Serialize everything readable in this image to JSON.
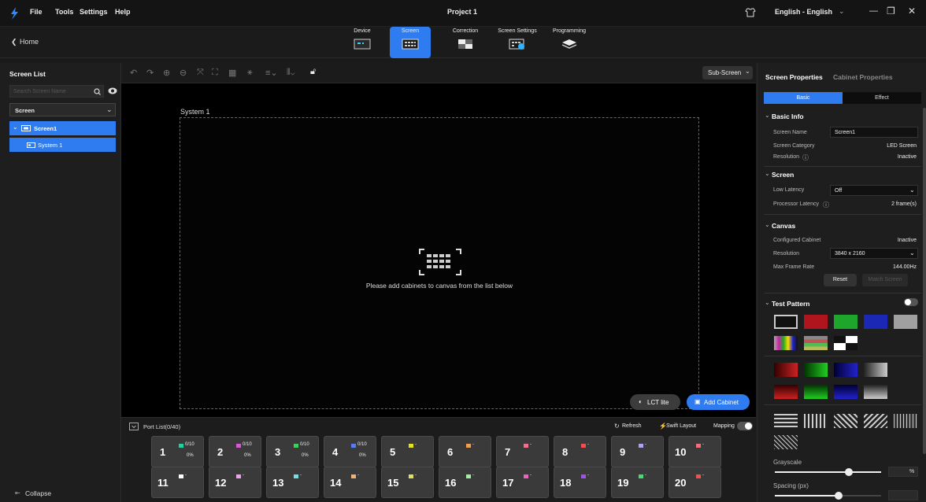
{
  "titlebar": {
    "menus": [
      "File",
      "Tools",
      "Settings",
      "Help"
    ],
    "project": "Project 1",
    "language": "English - English",
    "win_min": "—",
    "win_max": "❐",
    "win_close": "✕"
  },
  "nav": {
    "home": "Home",
    "tabs": [
      {
        "label": "Device"
      },
      {
        "label": "Screen",
        "active": true
      },
      {
        "label": "Correction"
      },
      {
        "label": "Screen Settings"
      },
      {
        "label": "Programming"
      }
    ]
  },
  "left": {
    "title": "Screen List",
    "search_placeholder": "Search Screen Name",
    "filter": "Screen",
    "tree": [
      {
        "label": "Screen1"
      },
      {
        "label": "System 1"
      }
    ],
    "collapse": "Collapse"
  },
  "canvas": {
    "subscreen": "Sub-Screen",
    "system_label": "System 1",
    "empty_msg": "Please add cabinets to canvas from the list below",
    "lct_btn": "LCT lite",
    "add_btn": "Add Cabinet"
  },
  "ports": {
    "title": "Port List(0/40)",
    "refresh": "Refresh",
    "swift": "Swift Layout",
    "mapping": "Mapping",
    "row1": [
      {
        "n": "1",
        "cnt": "0/10",
        "pct": "0%",
        "color": "#1fd1a0"
      },
      {
        "n": "2",
        "cnt": "0/10",
        "pct": "0%",
        "color": "#d65ad6"
      },
      {
        "n": "3",
        "cnt": "0/10",
        "pct": "0%",
        "color": "#3fcf5a"
      },
      {
        "n": "4",
        "cnt": "0/10",
        "pct": "0%",
        "color": "#5b7cf0"
      },
      {
        "n": "5",
        "cnt": "-",
        "pct": "",
        "color": "#e5e21b"
      },
      {
        "n": "6",
        "cnt": "-",
        "pct": "",
        "color": "#f0a050"
      },
      {
        "n": "7",
        "cnt": "-",
        "pct": "",
        "color": "#f07090"
      },
      {
        "n": "8",
        "cnt": "-",
        "pct": "",
        "color": "#f05050"
      },
      {
        "n": "9",
        "cnt": "-",
        "pct": "",
        "color": "#b0a0f0"
      },
      {
        "n": "10",
        "cnt": "-",
        "pct": "",
        "color": "#f07080"
      }
    ],
    "row2": [
      {
        "n": "11",
        "cnt": "-",
        "pct": "",
        "color": "#ffffff"
      },
      {
        "n": "12",
        "cnt": "-",
        "pct": "",
        "color": "#f0a0f0"
      },
      {
        "n": "13",
        "cnt": "-",
        "pct": "",
        "color": "#70e0e0"
      },
      {
        "n": "14",
        "cnt": "-",
        "pct": "",
        "color": "#f0b070"
      },
      {
        "n": "15",
        "cnt": "-",
        "pct": "",
        "color": "#e0e060"
      },
      {
        "n": "16",
        "cnt": "-",
        "pct": "",
        "color": "#a0f0a0"
      },
      {
        "n": "17",
        "cnt": "-",
        "pct": "",
        "color": "#f060c0"
      },
      {
        "n": "18",
        "cnt": "-",
        "pct": "",
        "color": "#a050f0"
      },
      {
        "n": "19",
        "cnt": "-",
        "pct": "",
        "color": "#40e070"
      },
      {
        "n": "20",
        "cnt": "-",
        "pct": "",
        "color": "#f05050"
      }
    ]
  },
  "right": {
    "tabs": [
      "Screen Properties",
      "Cabinet Properties"
    ],
    "sub_tabs": [
      "Basic",
      "Effect"
    ],
    "basic": {
      "title": "Basic Info",
      "name_label": "Screen Name",
      "name_value": "Screen1",
      "cat_label": "Screen Category",
      "cat_value": "LED Screen",
      "res_label": "Resolution",
      "res_value": "Inactive"
    },
    "screen": {
      "title": "Screen",
      "lowlat_label": "Low Latency",
      "lowlat_value": "Off",
      "proc_label": "Processor Latency",
      "proc_value": "2 frame(s)"
    },
    "canvas": {
      "title": "Canvas",
      "conf_label": "Configured Cabinet",
      "conf_value": "Inactive",
      "res_label": "Resolution",
      "res_value": "3840 x 2160",
      "fr_label": "Max Frame Rate",
      "fr_value": "144.00Hz",
      "reset": "Reset",
      "match": "Match Screen"
    },
    "test": {
      "title": "Test Pattern",
      "grayscale": "Grayscale",
      "gray_unit": "%",
      "spacing": "Spacing (px)",
      "swatches1": [
        "#111111",
        "#b0151e",
        "#1ea52c",
        "#1b28b5",
        "#a0a0a0"
      ]
    }
  }
}
